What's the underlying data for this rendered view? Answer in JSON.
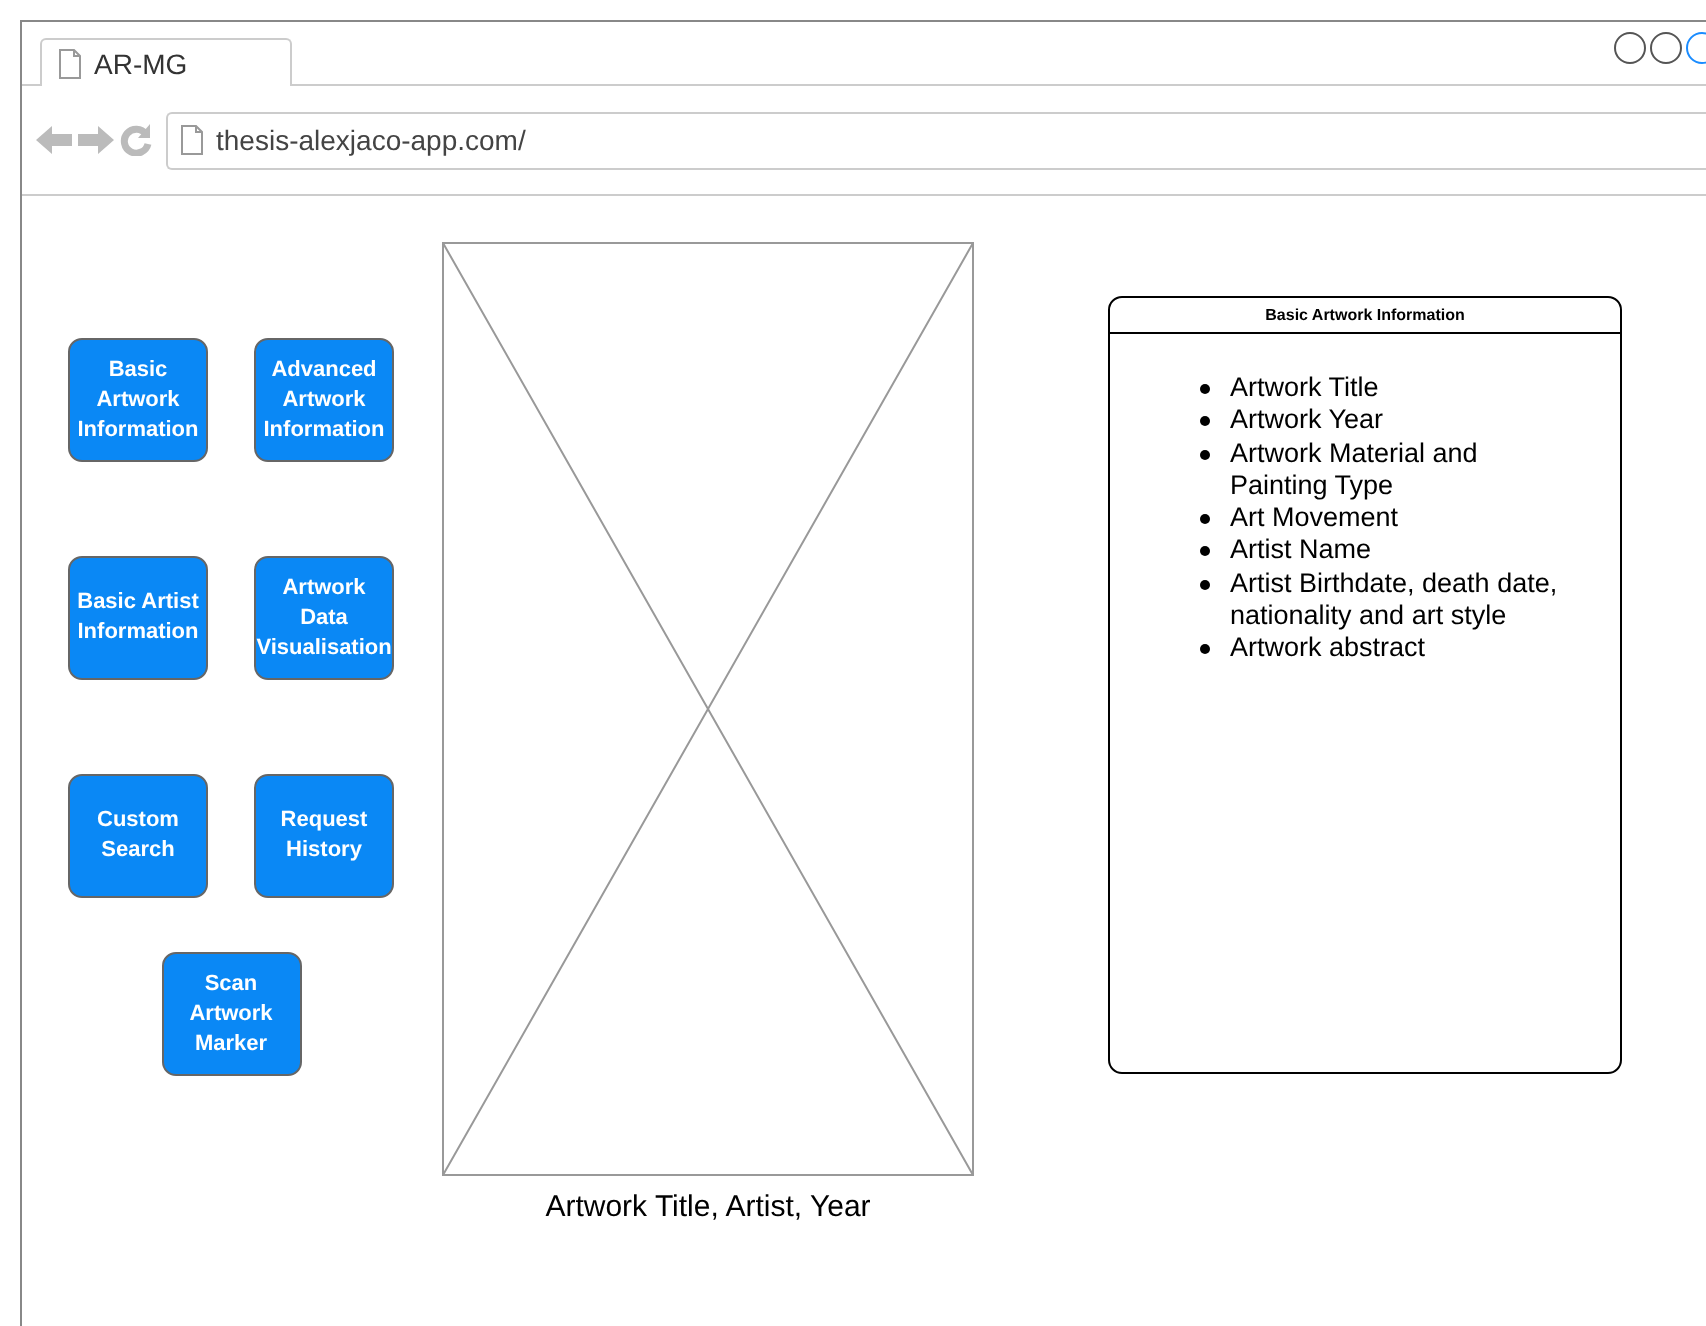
{
  "browser": {
    "tab_title": "AR-MG",
    "url": "thesis-alexjaco-app.com/"
  },
  "menu_buttons": [
    {
      "label": "Basic Artwork Information"
    },
    {
      "label": "Advanced Artwork Information"
    },
    {
      "label": "Basic Artist Information"
    },
    {
      "label": "Artwork Data Visualisation"
    },
    {
      "label": "Custom Search"
    },
    {
      "label": "Request History"
    },
    {
      "label": "Scan Artwork Marker"
    }
  ],
  "artwork": {
    "caption": "Artwork Title, Artist, Year"
  },
  "info_panel": {
    "title": "Basic Artwork Information",
    "items": [
      "Artwork Title",
      "Artwork Year",
      "Artwork Material and Painting Type",
      "Art Movement",
      "Artist Name",
      "Artist Birthdate, death date, nationality and art style",
      "Artwork abstract"
    ]
  }
}
